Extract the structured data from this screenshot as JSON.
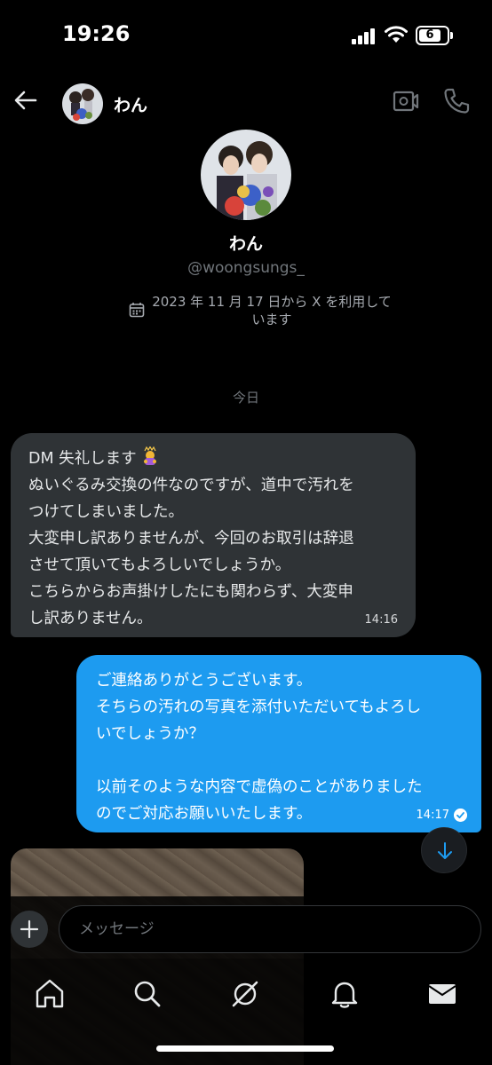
{
  "status_bar": {
    "time": "19:26",
    "battery": "6"
  },
  "header": {
    "name": "わん"
  },
  "profile": {
    "name": "わん",
    "handle": "@woongsungs_",
    "joined_line1": "2023 年 11 月 17 日から X を利用して",
    "joined_line2": "います"
  },
  "day_separator": "今日",
  "messages": [
    {
      "direction": "incoming",
      "lines": [
        "DM 失礼します",
        "ぬいぐるみ交換の件なのですが、道中で汚れを",
        "つけてしまいました。",
        "大変申し訳ありませんが、今回のお取引は辞退",
        "させて頂いてもよろしいでしょうか。",
        "こちらからお声掛けしたにも関わらず、大変申",
        "し訳ありません。"
      ],
      "time": "14:16",
      "emoji": "person-bowing-emoji"
    },
    {
      "direction": "outgoing",
      "lines": [
        "ご連絡ありがとうございます。",
        "そちらの汚れの写真を添付いただいてもよろし",
        "いでしょうか？",
        "",
        "以前そのような内容で虚偽のことがありました",
        "のでご対応お願いいたします。"
      ],
      "time": "14:17",
      "status": "read"
    }
  ],
  "composer": {
    "placeholder": "メッセージ"
  },
  "nav": {
    "items": [
      "home-icon",
      "search-icon",
      "grok-icon",
      "notifications-icon",
      "messages-icon"
    ]
  },
  "colors": {
    "background": "#000000",
    "accent": "#1d9bf0",
    "incoming_bubble": "#2f3336",
    "muted_text": "#71767b"
  }
}
